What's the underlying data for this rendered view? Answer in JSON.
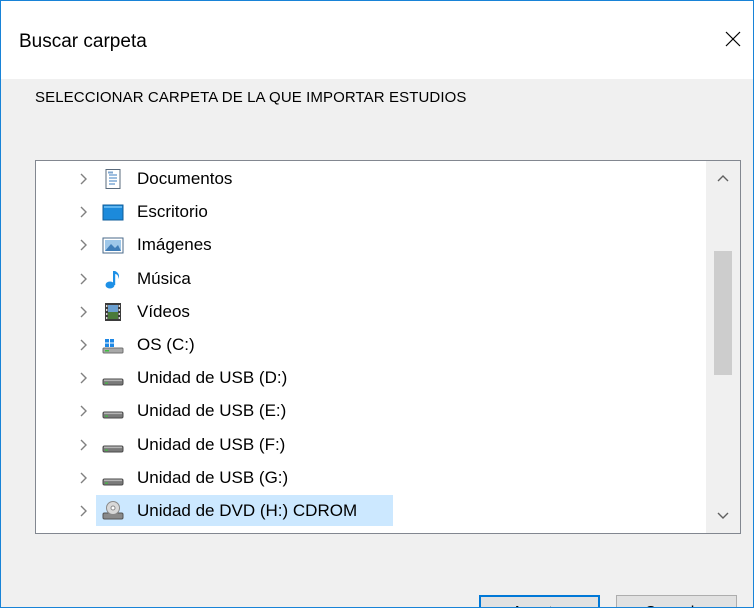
{
  "window": {
    "title": "Buscar carpeta",
    "close_icon": "close-icon"
  },
  "instruction": "SELECCIONAR CARPETA DE LA QUE IMPORTAR ESTUDIOS",
  "tree": {
    "items": [
      {
        "label": "Documentos",
        "icon": "documents-icon",
        "selected": false
      },
      {
        "label": "Escritorio",
        "icon": "desktop-icon",
        "selected": false
      },
      {
        "label": "Imágenes",
        "icon": "pictures-icon",
        "selected": false
      },
      {
        "label": "Música",
        "icon": "music-icon",
        "selected": false
      },
      {
        "label": "Vídeos",
        "icon": "videos-icon",
        "selected": false
      },
      {
        "label": "OS (C:)",
        "icon": "system-drive-icon",
        "selected": false
      },
      {
        "label": "Unidad de USB (D:)",
        "icon": "usb-drive-icon",
        "selected": false
      },
      {
        "label": "Unidad de USB (E:)",
        "icon": "usb-drive-icon",
        "selected": false
      },
      {
        "label": "Unidad de USB (F:)",
        "icon": "usb-drive-icon",
        "selected": false
      },
      {
        "label": "Unidad de USB (G:)",
        "icon": "usb-drive-icon",
        "selected": false
      },
      {
        "label": "Unidad de DVD (H:) CDROM",
        "icon": "dvd-drive-icon",
        "selected": true
      }
    ],
    "scroll_position": 0.42
  },
  "buttons": {
    "ok_label": "Aceptar",
    "cancel_label": "Cancelar"
  },
  "colors": {
    "accent": "#0078d7",
    "selection": "#cce8ff",
    "window_border": "#1883d7"
  }
}
